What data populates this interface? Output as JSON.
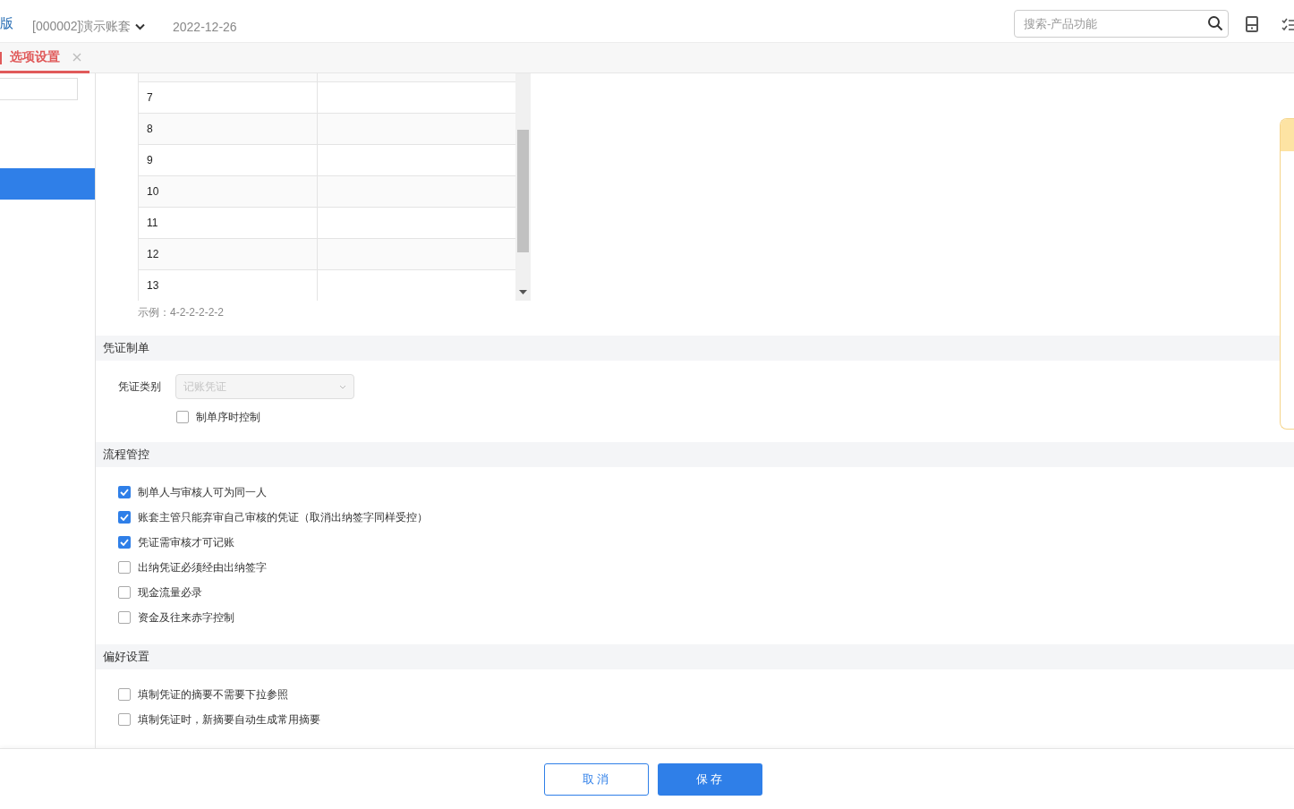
{
  "header": {
    "brand": "版",
    "account": "[000002]演示账套",
    "date": "2022-12-26",
    "search": {
      "placeholder": "搜索-产品功能"
    }
  },
  "tabs": [
    {
      "label": "选项设置",
      "selected": true
    }
  ],
  "sidebar": {
    "items": [
      {
        "selected": true
      }
    ]
  },
  "code_table": {
    "rows": [
      "7",
      "8",
      "9",
      "10",
      "11",
      "12",
      "13"
    ],
    "example": "示例：4-2-2-2-2-2"
  },
  "sections": [
    {
      "title": "凭证制单",
      "items": [
        {
          "kind": "select",
          "label": "凭证类别",
          "value": "记账凭证",
          "disabled": true,
          "option": {
            "label": "制单序时控制",
            "checked": false
          }
        }
      ]
    },
    {
      "title": "流程管控",
      "items": [
        {
          "kind": "checkbox",
          "label": "制单人与审核人可为同一人",
          "checked": true
        },
        {
          "kind": "checkbox",
          "label": "账套主管只能弃审自己审核的凭证（取消出纳签字同样受控）",
          "checked": true
        },
        {
          "kind": "checkbox",
          "label": "凭证需审核才可记账",
          "checked": true
        },
        {
          "kind": "checkbox",
          "label": "出纳凭证必须经由出纳签字",
          "checked": false
        },
        {
          "kind": "checkbox",
          "label": "现金流量必录",
          "checked": false
        },
        {
          "kind": "checkbox",
          "label": "资金及往来赤字控制",
          "checked": false
        }
      ]
    },
    {
      "title": "偏好设置",
      "items": [
        {
          "kind": "checkbox",
          "label": "填制凭证的摘要不需要下拉参照",
          "checked": false
        },
        {
          "kind": "checkbox",
          "label": "填制凭证时，新摘要自动生成常用摘要",
          "checked": false
        }
      ]
    }
  ],
  "buttons": [
    {
      "label": "取消",
      "kind": "secondary"
    },
    {
      "label": "保存",
      "kind": "primary"
    }
  ]
}
